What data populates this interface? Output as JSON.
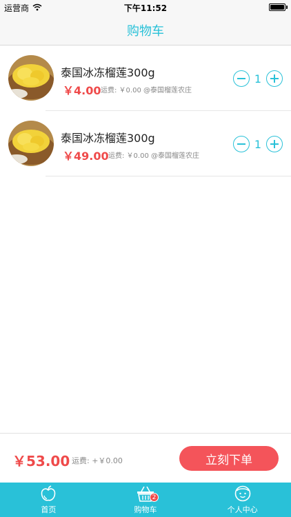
{
  "status_bar": {
    "carrier": "运营商",
    "time": "下午11:52"
  },
  "nav": {
    "title": "购物车"
  },
  "cart": {
    "items": [
      {
        "name": "泰国冰冻榴莲300g",
        "price": "￥4.00",
        "meta": "运费: ￥0.00 @泰国榴莲农庄",
        "quantity": "1"
      },
      {
        "name": "泰国冰冻榴莲300g",
        "price": "￥49.00",
        "meta": "运费: ￥0.00 @泰国榴莲农庄",
        "quantity": "1"
      }
    ]
  },
  "footer": {
    "total": "￥53.00",
    "shipping": "运费: +￥0.00",
    "checkout_label": "立刻下单"
  },
  "tabs": [
    {
      "label": "首页",
      "icon": "apple-icon"
    },
    {
      "label": "购物车",
      "icon": "basket-icon",
      "badge": "2"
    },
    {
      "label": "个人中心",
      "icon": "face-icon"
    }
  ],
  "colors": {
    "accent": "#29c1d8",
    "price": "#ef4a4a",
    "checkout": "#f4545a"
  }
}
